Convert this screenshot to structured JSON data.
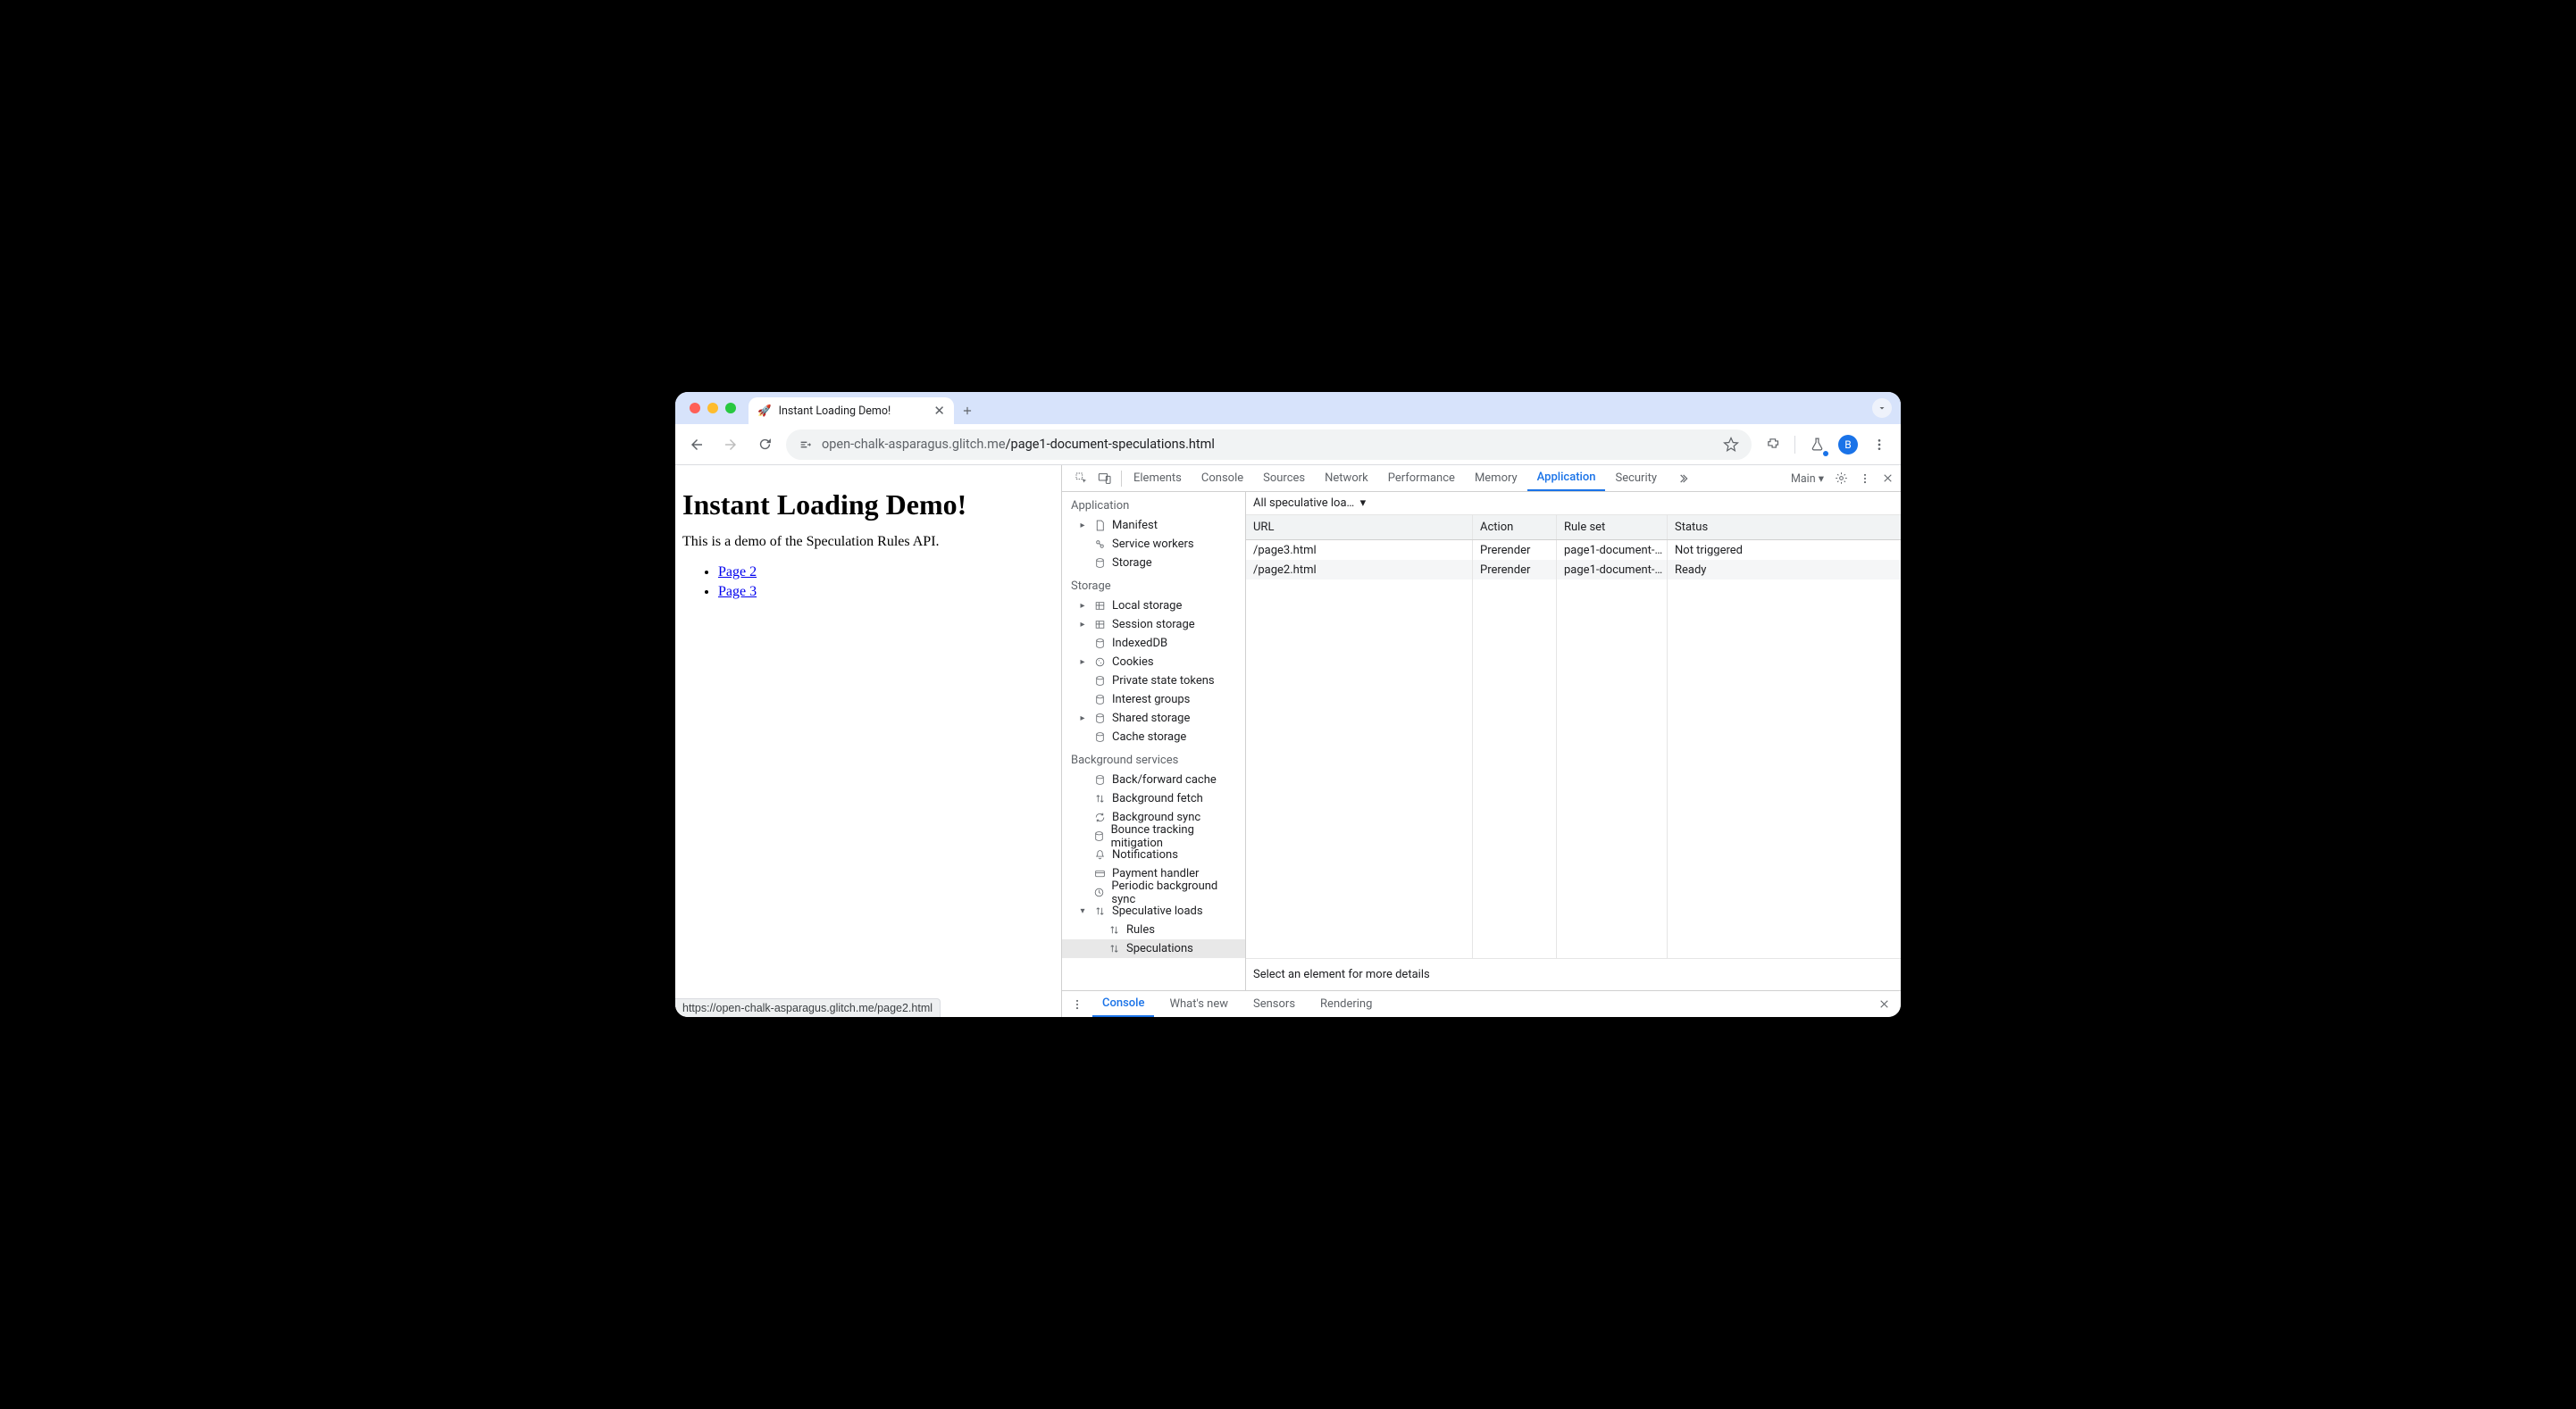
{
  "tab": {
    "title": "Instant Loading Demo!",
    "favicon": "🚀"
  },
  "omnibox": {
    "host": "open-chalk-asparagus.glitch.me",
    "path": "/page1-document-speculations.html"
  },
  "avatar_letter": "B",
  "page": {
    "heading": "Instant Loading Demo!",
    "paragraph": "This is a demo of the Speculation Rules API.",
    "links": [
      "Page 2",
      "Page 3"
    ],
    "status_hover": "https://open-chalk-asparagus.glitch.me/page2.html"
  },
  "devtools": {
    "tabs": [
      "Elements",
      "Console",
      "Sources",
      "Network",
      "Performance",
      "Memory",
      "Application",
      "Security"
    ],
    "active_tab": "Application",
    "target_label": "Main",
    "sidebar": {
      "application": {
        "title": "Application",
        "items": [
          "Manifest",
          "Service workers",
          "Storage"
        ]
      },
      "storage": {
        "title": "Storage",
        "items": [
          "Local storage",
          "Session storage",
          "IndexedDB",
          "Cookies",
          "Private state tokens",
          "Interest groups",
          "Shared storage",
          "Cache storage"
        ]
      },
      "background": {
        "title": "Background services",
        "items": [
          "Back/forward cache",
          "Background fetch",
          "Background sync",
          "Bounce tracking mitigation",
          "Notifications",
          "Payment handler",
          "Periodic background sync",
          "Speculative loads"
        ],
        "spec_children": [
          "Rules",
          "Speculations"
        ],
        "selected": "Speculations"
      }
    },
    "filter": "All speculative loa…",
    "columns": [
      "URL",
      "Action",
      "Rule set",
      "Status"
    ],
    "rows": [
      {
        "url": "/page3.html",
        "action": "Prerender",
        "ruleset": "page1-document-…",
        "status": "Not triggered"
      },
      {
        "url": "/page2.html",
        "action": "Prerender",
        "ruleset": "page1-document-…",
        "status": "Ready"
      }
    ],
    "detail_msg": "Select an element for more details",
    "drawer_tabs": [
      "Console",
      "What's new",
      "Sensors",
      "Rendering"
    ],
    "drawer_active": "Console"
  }
}
